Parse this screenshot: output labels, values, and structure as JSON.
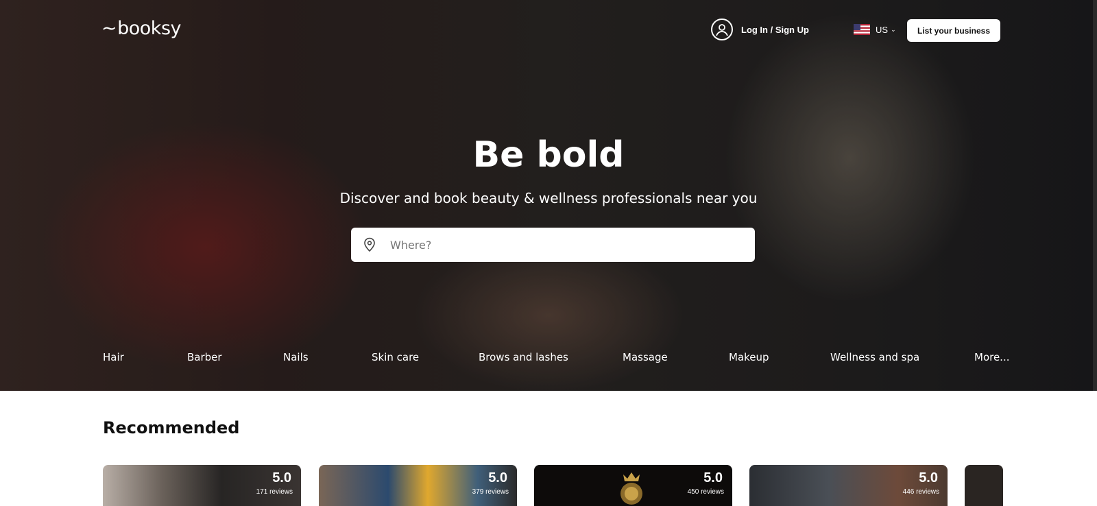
{
  "header": {
    "logo": "booksy",
    "login_label": "Log In / Sign Up",
    "locale": "US",
    "list_business_label": "List your business"
  },
  "hero": {
    "title": "Be bold",
    "subtitle": "Discover and book beauty & wellness professionals near you",
    "search_placeholder": "Where?"
  },
  "categories": [
    "Hair",
    "Barber",
    "Nails",
    "Skin care",
    "Brows and lashes",
    "Massage",
    "Makeup",
    "Wellness and spa",
    "More..."
  ],
  "recommended": {
    "title": "Recommended",
    "cards": [
      {
        "rating": "5.0",
        "reviews": "171 reviews"
      },
      {
        "rating": "5.0",
        "reviews": "379 reviews"
      },
      {
        "rating": "5.0",
        "reviews": "450 reviews"
      },
      {
        "rating": "5.0",
        "reviews": "446 reviews"
      }
    ]
  },
  "icons": {
    "account": "user-circle-icon",
    "locale_flag": "us-flag-icon",
    "locale_dropdown": "chevron-down-icon",
    "search_location": "map-pin-icon"
  }
}
